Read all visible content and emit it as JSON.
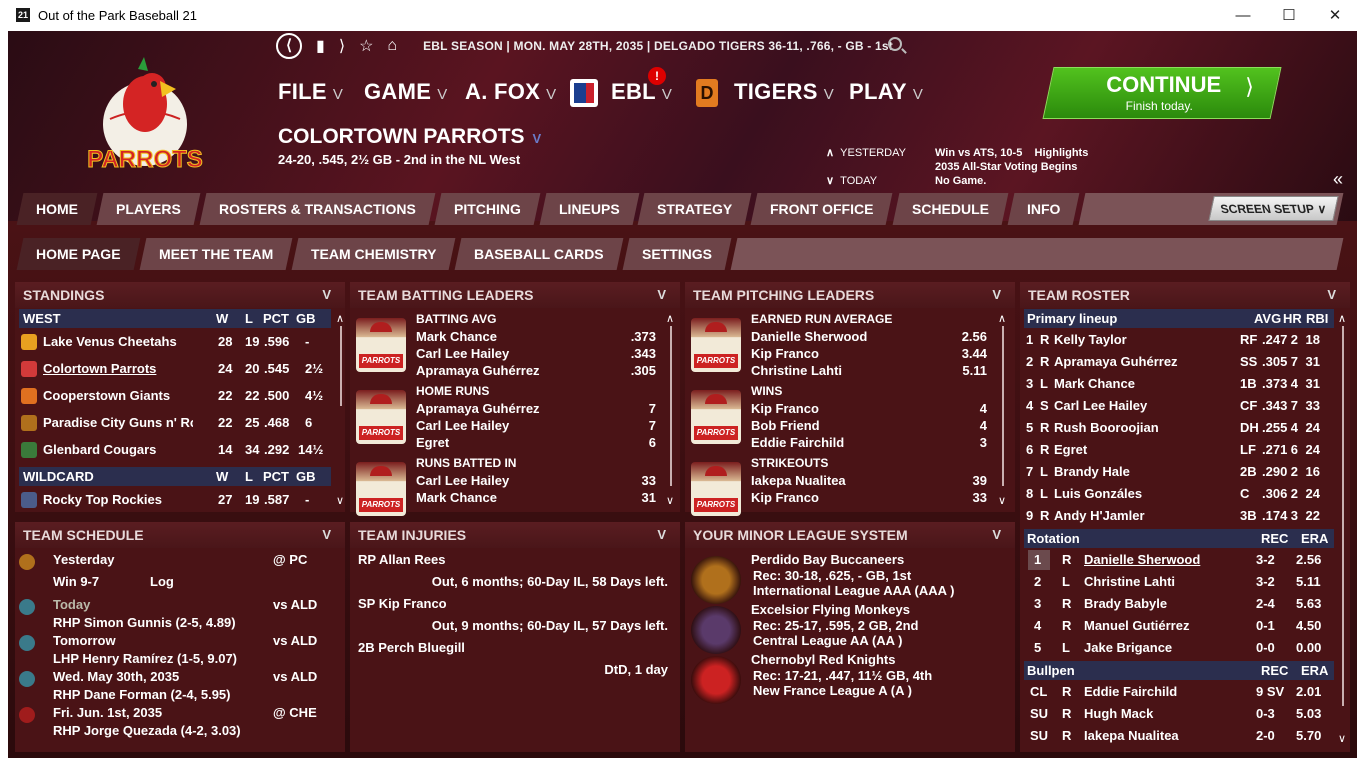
{
  "window": {
    "title": "Out of the Park Baseball 21",
    "icon_text": "21"
  },
  "topnav": {
    "season_info": "EBL SEASON  |  MON. MAY 28TH, 2035  |  DELGADO TIGERS  36-11, .766, - GB - 1st"
  },
  "menus": [
    {
      "label": "FILE"
    },
    {
      "label": "GAME"
    },
    {
      "label": "A. FOX"
    },
    {
      "label": "EBL"
    },
    {
      "label": "TIGERS"
    },
    {
      "label": "PLAY"
    }
  ],
  "badge": "!",
  "team": {
    "name": "COLORTOWN PARROTS",
    "record": "24-20, .545, 2½ GB - 2nd in the NL West",
    "logo_text": "PARROTS"
  },
  "yesterday": {
    "label": "YESTERDAY",
    "text": "Win vs ATS, 10-5",
    "link": "Highlights"
  },
  "today": {
    "label": "TODAY",
    "news": "2035 All-Star Voting Begins",
    "text": "No Game."
  },
  "continue": {
    "label": "CONTINUE",
    "sub": "Finish today."
  },
  "tabs_main": [
    "HOME",
    "PLAYERS",
    "ROSTERS & TRANSACTIONS",
    "PITCHING",
    "LINEUPS",
    "STRATEGY",
    "FRONT OFFICE",
    "SCHEDULE",
    "INFO"
  ],
  "screen_setup": "SCREEN SETUP",
  "tabs_sub": [
    "HOME PAGE",
    "MEET THE TEAM",
    "TEAM CHEMISTRY",
    "BASEBALL CARDS",
    "SETTINGS"
  ],
  "standings": {
    "title": "STANDINGS",
    "div": "WEST",
    "cols": [
      "W",
      "L",
      "PCT",
      "GB"
    ],
    "rows": [
      {
        "team": "Lake Venus Cheetahs",
        "w": "28",
        "l": "19",
        "pct": ".596",
        "gb": "-"
      },
      {
        "team": "Colortown Parrots",
        "w": "24",
        "l": "20",
        "pct": ".545",
        "gb": "2½"
      },
      {
        "team": "Cooperstown Giants",
        "w": "22",
        "l": "22",
        "pct": ".500",
        "gb": "4½"
      },
      {
        "team": "Paradise City Guns n' Ro:",
        "w": "22",
        "l": "25",
        "pct": ".468",
        "gb": "6"
      },
      {
        "team": "Glenbard Cougars",
        "w": "14",
        "l": "34",
        "pct": ".292",
        "gb": "14½"
      }
    ],
    "wildcard": "WILDCARD",
    "wc_rows": [
      {
        "team": "Rocky Top Rockies",
        "w": "27",
        "l": "19",
        "pct": ".587",
        "gb": "-"
      }
    ]
  },
  "batting": {
    "title": "TEAM BATTING LEADERS",
    "groups": [
      {
        "cat": "BATTING AVG",
        "rows": [
          [
            "Mark Chance",
            ".373"
          ],
          [
            "Carl Lee Hailey",
            ".343"
          ],
          [
            "Apramaya Guhérrez",
            ".305"
          ]
        ]
      },
      {
        "cat": "HOME RUNS",
        "rows": [
          [
            "Apramaya Guhérrez",
            "7"
          ],
          [
            "Carl Lee Hailey",
            "7"
          ],
          [
            "Egret",
            "6"
          ]
        ]
      },
      {
        "cat": "RUNS BATTED IN",
        "rows": [
          [
            "Carl Lee Hailey",
            "33"
          ],
          [
            "Mark Chance",
            "31"
          ]
        ]
      }
    ]
  },
  "pitching": {
    "title": "TEAM PITCHING LEADERS",
    "groups": [
      {
        "cat": "EARNED RUN AVERAGE",
        "rows": [
          [
            "Danielle Sherwood",
            "2.56"
          ],
          [
            "Kip Franco",
            "3.44"
          ],
          [
            "Christine Lahti",
            "5.11"
          ]
        ]
      },
      {
        "cat": "WINS",
        "rows": [
          [
            "Kip Franco",
            "4"
          ],
          [
            "Bob Friend",
            "4"
          ],
          [
            "Eddie Fairchild",
            "3"
          ]
        ]
      },
      {
        "cat": "STRIKEOUTS",
        "rows": [
          [
            "Iakepa Nualitea",
            "39"
          ],
          [
            "Kip Franco",
            "33"
          ]
        ]
      }
    ]
  },
  "roster": {
    "title": "TEAM ROSTER",
    "lineup_head": [
      "Primary lineup",
      "AVG",
      "HR",
      "RBI"
    ],
    "lineup": [
      [
        "1",
        "R",
        "Kelly Taylor",
        "RF",
        ".247",
        "2",
        "18"
      ],
      [
        "2",
        "R",
        "Apramaya Guhérrez",
        "SS",
        ".305",
        "7",
        "31"
      ],
      [
        "3",
        "L",
        "Mark Chance",
        "1B",
        ".373",
        "4",
        "31"
      ],
      [
        "4",
        "S",
        "Carl Lee Hailey",
        "CF",
        ".343",
        "7",
        "33"
      ],
      [
        "5",
        "R",
        "Rush Booroojian",
        "DH",
        ".255",
        "4",
        "24"
      ],
      [
        "6",
        "R",
        "Egret",
        "LF",
        ".271",
        "6",
        "24"
      ],
      [
        "7",
        "L",
        "Brandy Hale",
        "2B",
        ".290",
        "2",
        "16"
      ],
      [
        "8",
        "L",
        "Luis Gonzáles",
        "C",
        ".306",
        "2",
        "24"
      ],
      [
        "9",
        "R",
        "Andy H'Jamler",
        "3B",
        ".174",
        "3",
        "22"
      ]
    ],
    "rotation_head": [
      "Rotation",
      "REC",
      "ERA"
    ],
    "rotation": [
      [
        "1",
        "R",
        "Danielle Sherwood",
        "3-2",
        "2.56"
      ],
      [
        "2",
        "L",
        "Christine Lahti",
        "3-2",
        "5.11"
      ],
      [
        "3",
        "R",
        "Brady Babyle",
        "2-4",
        "5.63"
      ],
      [
        "4",
        "R",
        "Manuel Gutiérrez",
        "0-1",
        "4.50"
      ],
      [
        "5",
        "L",
        "Jake Brigance",
        "0-0",
        "0.00"
      ]
    ],
    "bullpen_head": [
      "Bullpen",
      "REC",
      "ERA"
    ],
    "bullpen": [
      [
        "CL",
        "R",
        "Eddie Fairchild",
        "9 SV",
        "2.01"
      ],
      [
        "SU",
        "R",
        "Hugh Mack",
        "0-3",
        "5.03"
      ],
      [
        "SU",
        "R",
        "Iakepa Nualitea",
        "2-0",
        "5.70"
      ]
    ]
  },
  "schedule": {
    "title": "TEAM SCHEDULE",
    "rows": [
      {
        "day": "Yesterday",
        "opp": "@ PC",
        "detail": "Win 9-7",
        "extra": "Log"
      },
      {
        "day": "Today",
        "opp": "vs ALD",
        "detail": "RHP Simon Gunnis (2-5, 4.89)"
      },
      {
        "day": "Tomorrow",
        "opp": "vs ALD",
        "detail": "LHP Henry Ramírez (1-5, 9.07)"
      },
      {
        "day": "Wed. May 30th, 2035",
        "opp": "vs ALD",
        "detail": "RHP Dane Forman (2-4, 5.95)"
      },
      {
        "day": "Fri. Jun. 1st, 2035",
        "opp": "@ CHE",
        "detail": "RHP Jorge Quezada (4-2, 3.03)"
      }
    ]
  },
  "injuries": {
    "title": "TEAM INJURIES",
    "rows": [
      {
        "player": "RP Allan Rees",
        "status": "Out, 6 months; 60-Day IL, 58 Days left."
      },
      {
        "player": "SP Kip Franco",
        "status": "Out, 9 months; 60-Day IL, 57 Days left."
      },
      {
        "player": "2B Perch Bluegill",
        "status": "DtD, 1 day"
      }
    ]
  },
  "minors": {
    "title": "YOUR MINOR LEAGUE SYSTEM",
    "rows": [
      {
        "team": "Perdido Bay Buccaneers",
        "rec": "Rec: 30-18, .625, - GB, 1st",
        "league": "International League AAA (AAA )"
      },
      {
        "team": "Excelsior Flying Monkeys",
        "rec": "Rec: 25-17, .595, 2 GB, 2nd",
        "league": "Central League AA (AA )"
      },
      {
        "team": "Chernobyl Red Knights",
        "rec": "Rec: 17-21, .447, 11½ GB, 4th",
        "league": "New France League A (A )"
      }
    ]
  }
}
